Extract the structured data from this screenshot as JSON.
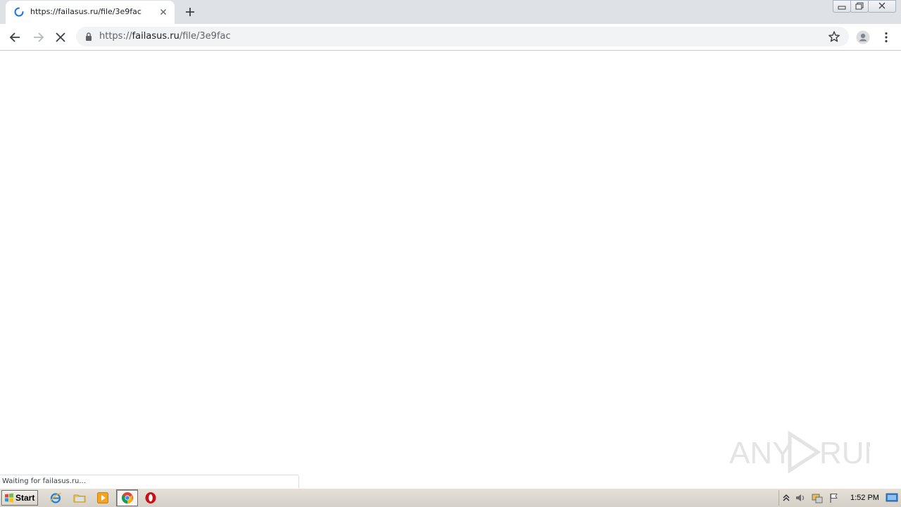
{
  "browser": {
    "tab": {
      "title": "https://failasus.ru/file/3e9fac"
    },
    "omnibox": {
      "scheme": "https://",
      "host": "failasus.ru",
      "path": "/file/3e9fac"
    },
    "status_text": "Waiting for failasus.ru...",
    "accent_color": "#1a73e8"
  },
  "watermark": {
    "text": "ANY RUN"
  },
  "taskbar": {
    "start_label": "Start",
    "pinned": [
      "ie-icon",
      "explorer-icon",
      "media-player-icon",
      "chrome-icon",
      "opera-icon"
    ],
    "tray": [
      "show-hidden-icon",
      "volume-icon",
      "network-icon",
      "action-center-flag-icon"
    ],
    "clock": "1:52 PM"
  }
}
